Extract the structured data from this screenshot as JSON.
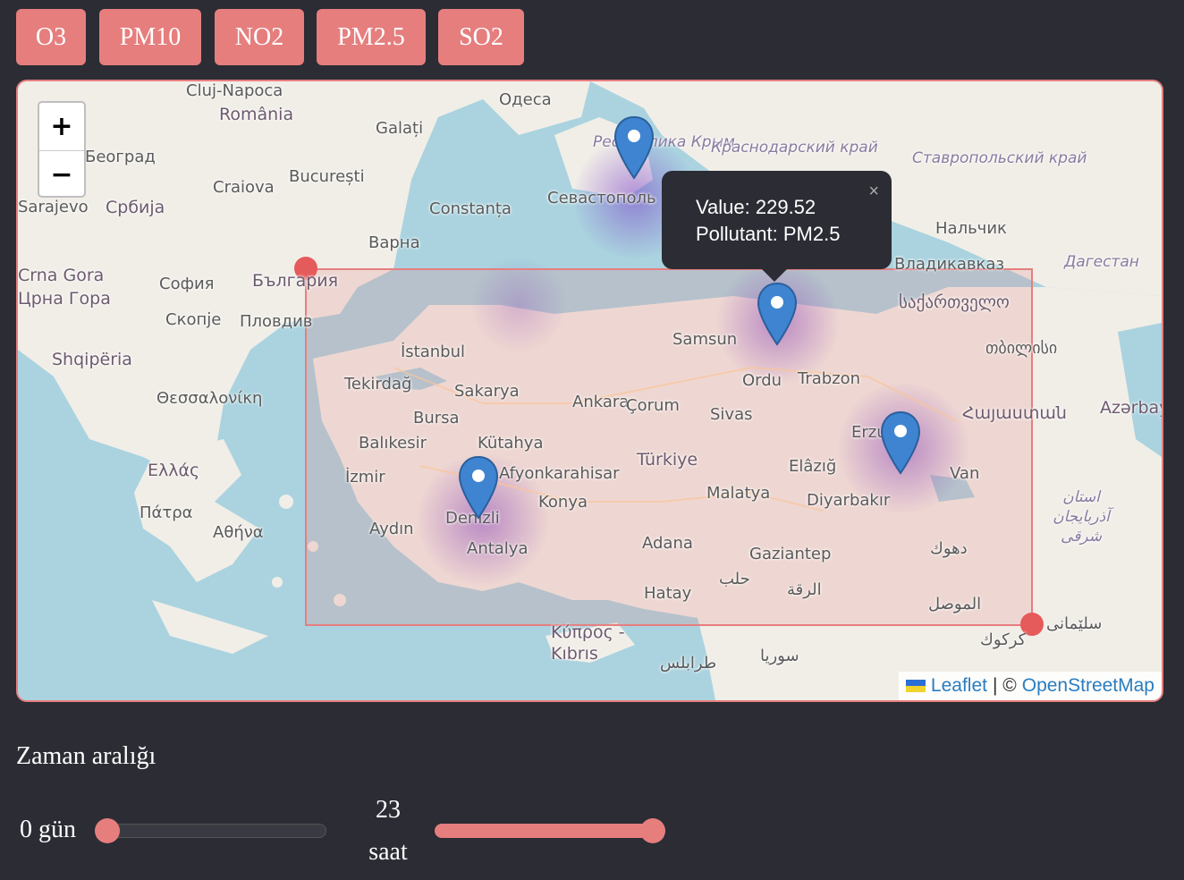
{
  "pollutant_buttons": [
    "O3",
    "PM10",
    "NO2",
    "PM2.5",
    "SO2"
  ],
  "colors": {
    "accent": "#e67e7e",
    "background": "#2b2c34",
    "sea": "#aad3df",
    "land": "#f1eee8",
    "marker": "#3f84d0"
  },
  "map": {
    "zoom_in": "+",
    "zoom_out": "−",
    "place_labels": [
      "Cluj-Napoca",
      "România",
      "Одеса",
      "Galați",
      "Београд",
      "Craiova",
      "București",
      "Србија",
      "Constanța",
      "Варна",
      "Севастополь",
      "Республика Крым",
      "Краснодарский край",
      "Ставропольский край",
      "Нальчик",
      "Владикавказ",
      "Дагестан",
      "Crna Gora",
      "Црна Гора",
      "София",
      "България",
      "Скопје",
      "Пловдив",
      "Shqipëria",
      "Θεσσαλονίκη",
      "İstanbul",
      "Tekirdağ",
      "Sakarya",
      "Bursa",
      "Balıkesir",
      "Kütahya",
      "İzmir",
      "Ankara",
      "Çorum",
      "Samsun",
      "Ordu",
      "Trabzon",
      "Sivas",
      "Erzurum",
      "Türkiye",
      "Elâzığ",
      "Van",
      "Afyonkarahisar",
      "Konya",
      "Malatya",
      "Diyarbakır",
      "Denizli",
      "Aydın",
      "Antalya",
      "Adana",
      "Gaziantep",
      "Hatay",
      "Κύπρος - Kıbrıs",
      "Ελλάς",
      "Πάτρα",
      "Αθήνα",
      "საქართველო",
      "თბილისი",
      "Հայաստան",
      "Azərbaycan",
      "استان آذربایجان شرقی",
      "دهوك",
      "الموصل",
      "الرقة",
      "حلب",
      "سوريا",
      "طرابلس",
      "كركوك",
      "سلێمانی",
      "Sarajevo"
    ],
    "popup": {
      "value_text": "Value: 229.52",
      "pollutant_text": "Pollutant: PM2.5"
    },
    "attribution": {
      "leaflet": "Leaflet",
      "separator": "| ©",
      "osm": "OpenStreetMap"
    },
    "markers": [
      "Crimea",
      "Samsun",
      "Denizli",
      "Erzurum"
    ]
  },
  "time_range": {
    "title": "Zaman aralığı",
    "day_label": "0 gün",
    "hour_value": "23",
    "hour_unit": "saat",
    "day_slider_value": 0,
    "hour_slider_value": 23
  }
}
